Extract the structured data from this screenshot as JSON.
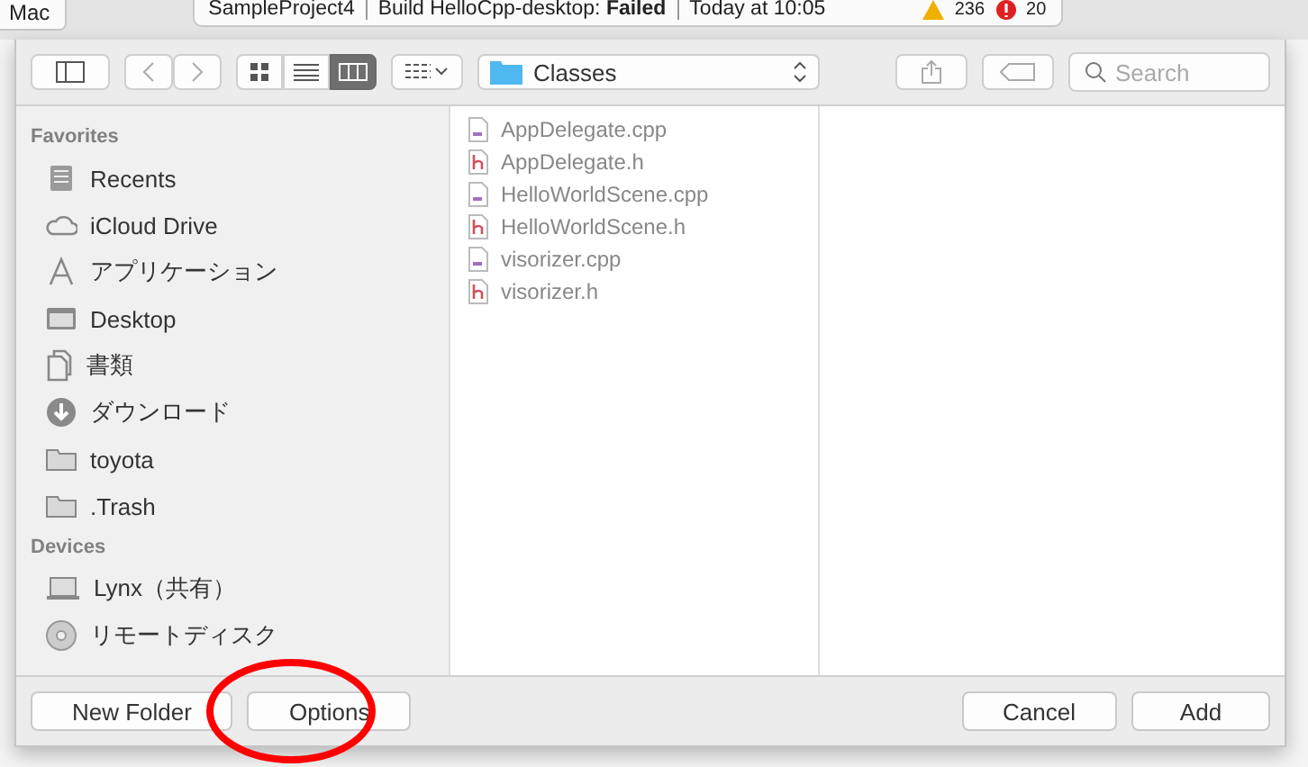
{
  "xcode_toolbar": {
    "scheme_button": "Mac",
    "activity": {
      "project": "SampleProject4",
      "build_prefix": "Build HelloCpp-desktop: ",
      "build_status": "Failed",
      "time": "Today at 10:05",
      "warnings": "236",
      "errors": "20"
    }
  },
  "dialog": {
    "toolbar": {
      "view_modes": [
        {
          "kind": "icons",
          "selected": false
        },
        {
          "kind": "list",
          "selected": false
        },
        {
          "kind": "columns",
          "selected": true
        }
      ],
      "location": "Classes",
      "search": {
        "placeholder": "Search"
      }
    },
    "sidebar": [
      {
        "heading": "Favorites",
        "items": [
          {
            "label": "Recents",
            "kind": "recents"
          },
          {
            "label": "iCloud Drive",
            "kind": "cloud"
          },
          {
            "label": "アプリケーション",
            "kind": "apps"
          },
          {
            "label": "Desktop",
            "kind": "desktop"
          },
          {
            "label": "書類",
            "kind": "documents"
          },
          {
            "label": "ダウンロード",
            "kind": "download"
          },
          {
            "label": "toyota",
            "kind": "folder"
          },
          {
            "label": ".Trash",
            "kind": "folder"
          }
        ]
      },
      {
        "heading": "Devices",
        "items": [
          {
            "label": "Lynx（共有）",
            "kind": "laptop"
          },
          {
            "label": "リモートディスク",
            "kind": "disc"
          }
        ]
      }
    ],
    "files": [
      {
        "name": "AppDelegate.cpp",
        "kind": "cpp"
      },
      {
        "name": "AppDelegate.h",
        "kind": "h"
      },
      {
        "name": "HelloWorldScene.cpp",
        "kind": "cpp"
      },
      {
        "name": "HelloWorldScene.h",
        "kind": "h"
      },
      {
        "name": "visorizer.cpp",
        "kind": "cpp"
      },
      {
        "name": "visorizer.h",
        "kind": "h"
      }
    ],
    "buttons_left": [
      {
        "label": "New Folder",
        "circled": false
      },
      {
        "label": "Options",
        "circled": true
      }
    ],
    "buttons_right": [
      "Cancel",
      "Add"
    ]
  }
}
